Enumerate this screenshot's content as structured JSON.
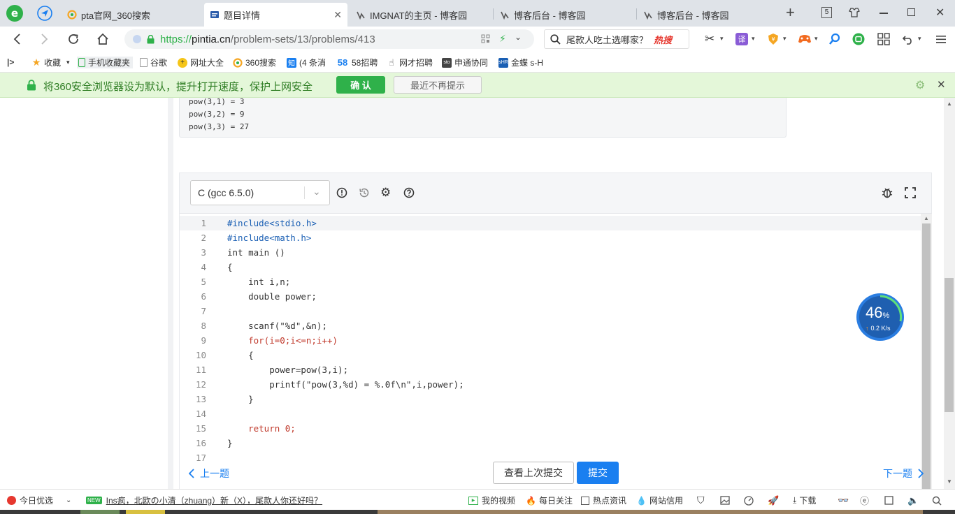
{
  "browser": {
    "tabs": [
      {
        "title": "pta官网_360搜索",
        "active": false
      },
      {
        "title": "题目详情",
        "active": true
      },
      {
        "title": "IMGNAT的主页 - 博客园",
        "active": false
      },
      {
        "title": "博客后台 - 博客园",
        "active": false
      },
      {
        "title": "博客后台 - 博客园",
        "active": false
      }
    ],
    "tab_count": "5",
    "url_scheme": "https://",
    "url_host": "pintia.cn",
    "url_path": "/problem-sets/13/problems/413",
    "search_text": "尾款人吃土选哪家？",
    "search_badge": "热搜",
    "translate_label": "译"
  },
  "bookmarks": [
    {
      "label": "收藏",
      "icon": "star-icon"
    },
    {
      "label": "手机收藏夹",
      "icon": "phone-icon"
    },
    {
      "label": "谷歌",
      "icon": "page-icon"
    },
    {
      "label": "网址大全",
      "icon": "globe-icon"
    },
    {
      "label": "360搜索",
      "icon": "search360-icon"
    },
    {
      "label": "(4 条消",
      "icon": "zhihu-icon"
    },
    {
      "label": "58招聘",
      "icon": "58-icon"
    },
    {
      "label": "网才招聘",
      "icon": "hand-icon"
    },
    {
      "label": "申通协同",
      "icon": "sto-icon"
    },
    {
      "label": "金蝶 s-H",
      "icon": "kingdee-icon"
    }
  ],
  "notice": {
    "text": "将360安全浏览器设为默认，提升打开速度，保护上网安全",
    "confirm": "确 认",
    "dismiss": "最近不再提示"
  },
  "output_sample": [
    "pow(3,1) = 3",
    "pow(3,2) = 9",
    "pow(3,3) = 27"
  ],
  "editor": {
    "language": "C (gcc 6.5.0)",
    "lines": [
      {
        "n": "1",
        "t": "#include<stdio.h>"
      },
      {
        "n": "2",
        "t": "#include<math.h>"
      },
      {
        "n": "3",
        "t": "int main ()"
      },
      {
        "n": "4",
        "t": "{"
      },
      {
        "n": "5",
        "t": "    int i,n;"
      },
      {
        "n": "6",
        "t": "    double power;"
      },
      {
        "n": "7",
        "t": "    "
      },
      {
        "n": "8",
        "t": "    scanf(\"%d\",&n);"
      },
      {
        "n": "9",
        "t": "    for(i=0;i<=n;i++)"
      },
      {
        "n": "10",
        "t": "    {"
      },
      {
        "n": "11",
        "t": "        power=pow(3,i);"
      },
      {
        "n": "12",
        "t": "        printf(\"pow(3,%d) = %.0f\\n\",i,power);"
      },
      {
        "n": "13",
        "t": "    }"
      },
      {
        "n": "14",
        "t": "    "
      },
      {
        "n": "15",
        "t": "    return 0;"
      },
      {
        "n": "16",
        "t": "}"
      },
      {
        "n": "17",
        "t": ""
      }
    ]
  },
  "footer": {
    "prev": "上一题",
    "view_last": "查看上次提交",
    "submit": "提交",
    "next": "下一题"
  },
  "speed_widget": {
    "percent": "46",
    "unit": "%",
    "rate": "0.2 K/s"
  },
  "statusbar": {
    "today": "今日优选",
    "new_badge": "NEW",
    "headline": "Ins疯，北欧の小清（zhuang）新（X），尾款人你还好吗？",
    "items": [
      "我的视频",
      "每日关注",
      "热点资讯",
      "网站信用"
    ],
    "download": "下载"
  },
  "colors": {
    "accent": "#1a7ff0",
    "green": "#3ab54a",
    "keyword": "#c0392b",
    "include": "#1a5fb4"
  }
}
